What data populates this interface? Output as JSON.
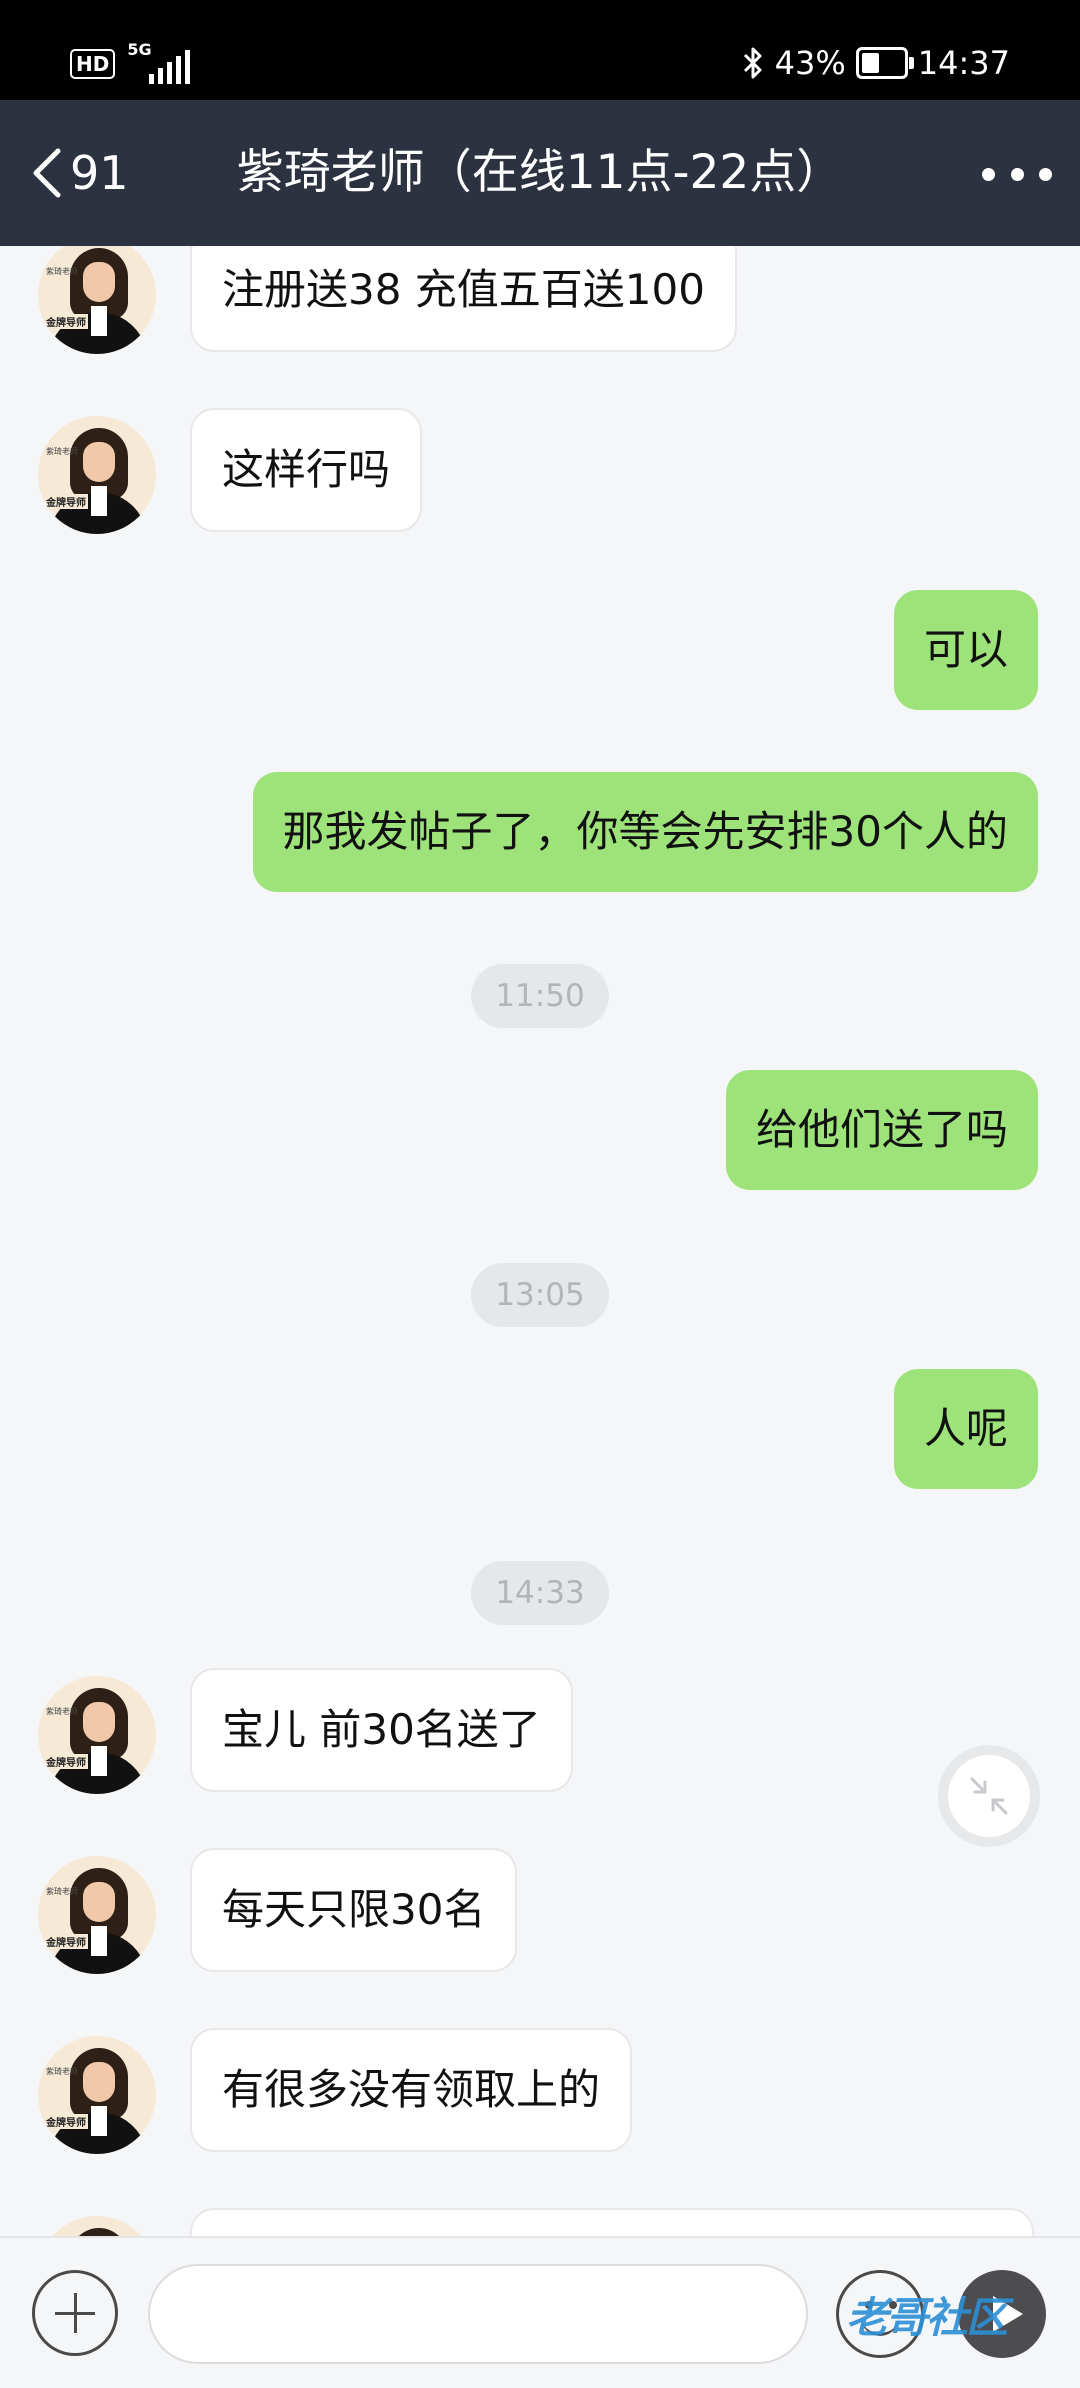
{
  "status_bar": {
    "hd": "HD",
    "network": "5G",
    "battery_percent": "43%",
    "battery_level": 0.43,
    "time": "14:37"
  },
  "header": {
    "back_count": "91",
    "title": "紫琦老师（在线11点-22点）"
  },
  "avatar_labels": {
    "top": "紫琦老师",
    "badge": "金牌导师"
  },
  "messages": [
    {
      "side": "in",
      "text": "注册送38 充值五百送100"
    },
    {
      "side": "in",
      "text": "这样行吗"
    },
    {
      "side": "out",
      "text": "可以"
    },
    {
      "side": "out",
      "text": "那我发帖子了，你等会先安排30个人的"
    },
    {
      "side": "time",
      "text": "11:50"
    },
    {
      "side": "out",
      "text": "给他们送了吗"
    },
    {
      "side": "time",
      "text": "13:05"
    },
    {
      "side": "out",
      "text": "人呢"
    },
    {
      "side": "time",
      "text": "14:33"
    },
    {
      "side": "in",
      "text": "宝儿 前30名送了"
    },
    {
      "side": "in",
      "text": "每天只限30名"
    },
    {
      "side": "in",
      "text": "有很多没有领取上的"
    },
    {
      "side": "in",
      "text": ""
    }
  ],
  "input": {
    "value": "",
    "placeholder": ""
  },
  "watermark": "老哥社区",
  "colors": {
    "header_bg": "#2d3240",
    "outgoing_bubble": "#9de37a",
    "incoming_bubble": "#ffffff",
    "chat_bg": "#f5f6f8"
  },
  "icons": {
    "back": "chevron-left-icon",
    "more": "more-dots-icon",
    "floating": "collapse-arrows-icon",
    "plus": "plus-icon",
    "emoji": "emoji-icon",
    "send": "send-icon"
  }
}
